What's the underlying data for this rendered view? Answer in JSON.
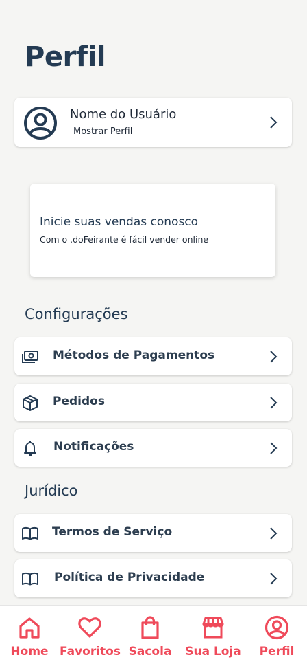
{
  "page_title": "Perfil",
  "profile": {
    "name": "Nome do Usuário",
    "link": "Mostrar Perfil"
  },
  "promo": {
    "title": "Inicie suas vendas conosco",
    "subtitle": "Com o .doFeirante é fácil vender online"
  },
  "settings": {
    "title": "Configurações",
    "items": [
      {
        "label": "Métodos de Pagamentos",
        "icon": "money-icon"
      },
      {
        "label": "Pedidos",
        "icon": "package-icon"
      },
      {
        "label": "Notificações",
        "icon": "bell-icon"
      }
    ]
  },
  "legal": {
    "title": "Jurídico",
    "items": [
      {
        "label": "Termos de Serviço",
        "icon": "book-icon"
      },
      {
        "label": "Política de Privacidade",
        "icon": "book-icon"
      }
    ]
  },
  "nav": {
    "accent_color": "#ef4a5a",
    "items": [
      {
        "label": "Home",
        "icon": "home-icon"
      },
      {
        "label": "Favoritos",
        "icon": "heart-icon"
      },
      {
        "label": "Sacola",
        "icon": "bag-icon"
      },
      {
        "label": "Sua Loja",
        "icon": "store-icon"
      },
      {
        "label": "Perfil",
        "icon": "user-circle-icon"
      }
    ]
  }
}
